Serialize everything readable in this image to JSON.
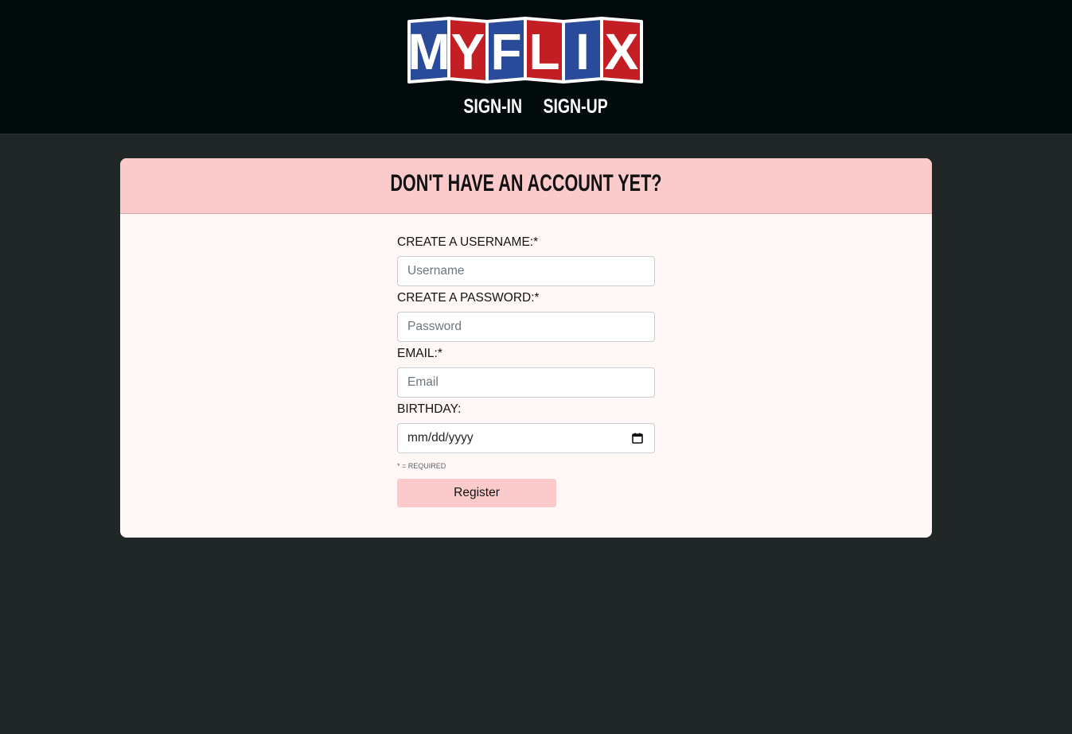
{
  "brand": {
    "logo_text": "MYFLIX",
    "colors": [
      "#2a4a9a",
      "#c41e25",
      "#2a4a9a",
      "#c41e25",
      "#2a4a9a",
      "#c41e25"
    ]
  },
  "nav": {
    "sign_in": "SIGN-IN",
    "sign_up": "SIGN-UP"
  },
  "card": {
    "title": "DON'T HAVE AN ACCOUNT YET?"
  },
  "form": {
    "username": {
      "label": "CREATE A USERNAME:*",
      "placeholder": "Username",
      "value": ""
    },
    "password": {
      "label": "CREATE A PASSWORD:*",
      "placeholder": "Password",
      "value": ""
    },
    "email": {
      "label": "EMAIL:*",
      "placeholder": "Email",
      "value": ""
    },
    "birthday": {
      "label": "BIRTHDAY:",
      "display_value": "mm/dd/yyyy",
      "icon": "calendar-icon"
    },
    "required_note": "* = REQUIRED",
    "submit_label": "Register"
  },
  "theme": {
    "header_bg": "#010b0c",
    "page_bg": "#202726",
    "card_bg": "#fff8f7",
    "accent_pink": "#fbcbcb"
  }
}
